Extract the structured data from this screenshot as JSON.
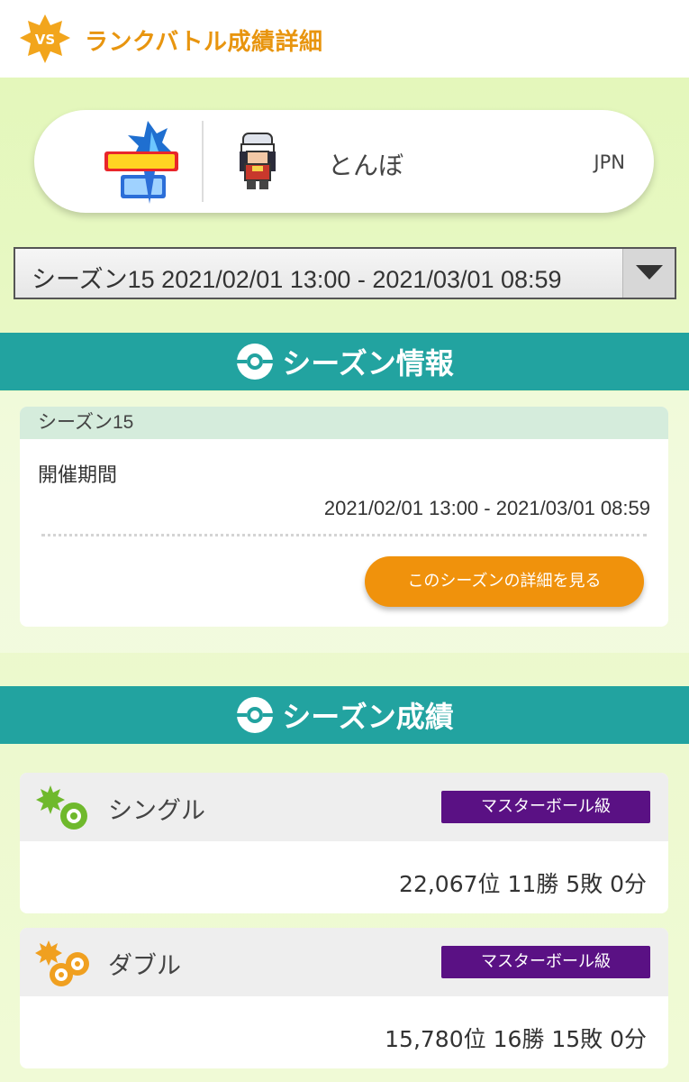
{
  "header": {
    "title": "ランクバトル成績詳細",
    "badge_text": "VS"
  },
  "player": {
    "game_icon": "pokemon-sword-logo",
    "avatar_icon": "trainer-sprite",
    "name": "とんぼ",
    "country": "JPN"
  },
  "season_select": {
    "selected": "シーズン15 2021/02/01 13:00 - 2021/03/01 08:59"
  },
  "season_info": {
    "section_title": "シーズン情報",
    "card_title": "シーズン15",
    "period_label": "開催期間",
    "period_value": "2021/02/01 13:00 - 2021/03/01 08:59",
    "detail_button": "このシーズンの詳細を見る"
  },
  "season_results": {
    "section_title": "シーズン成績",
    "items": [
      {
        "label": "シングル",
        "rank_badge": "マスターボール級",
        "stats": "22,067位 11勝 5敗 0分",
        "icon": "single-battle-icon"
      },
      {
        "label": "ダブル",
        "rank_badge": "マスターボール級",
        "stats": "15,780位 16勝 15敗 0分",
        "icon": "double-battle-icon"
      }
    ]
  },
  "colors": {
    "accent_orange": "#f0920c",
    "section_teal": "#22a3a0",
    "rank_purple": "#5a1184",
    "single_green": "#6fb92c",
    "double_orange": "#f0a020"
  }
}
